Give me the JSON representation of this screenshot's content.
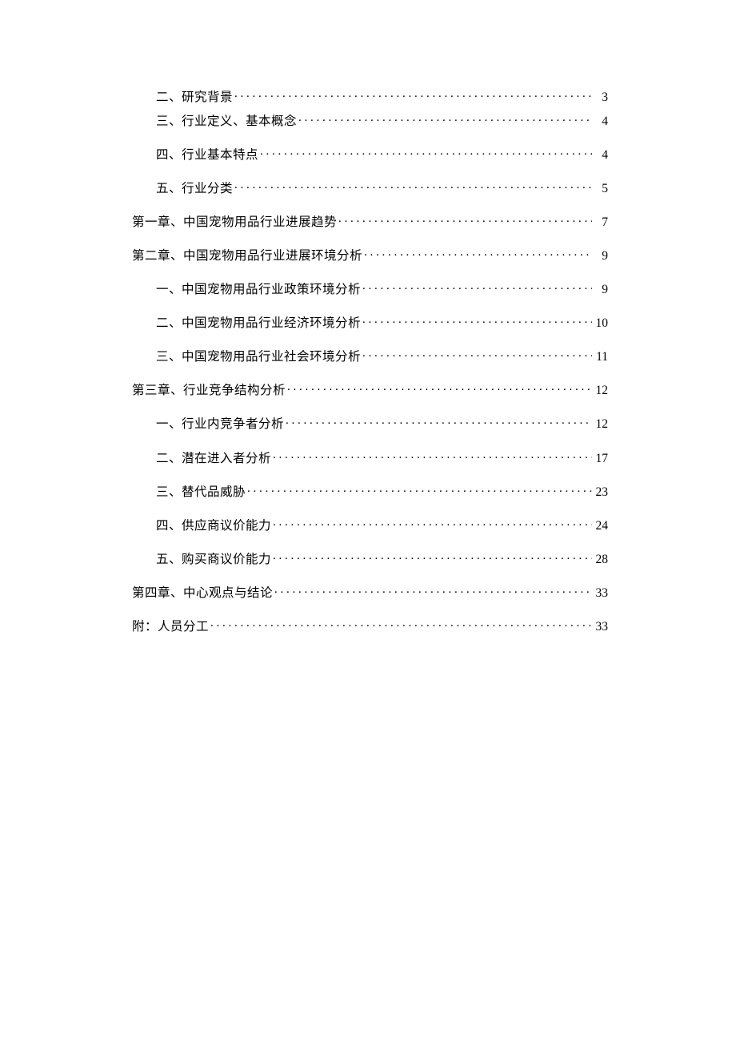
{
  "toc": [
    {
      "indent": true,
      "tight": true,
      "label": "二、研究背景",
      "page": "3"
    },
    {
      "indent": true,
      "tight": false,
      "label": "三、行业定义、基本概念",
      "page": "4"
    },
    {
      "indent": true,
      "tight": false,
      "label": "四、行业基本特点",
      "page": "4"
    },
    {
      "indent": true,
      "tight": false,
      "label": "五、行业分类",
      "page": "5"
    },
    {
      "indent": false,
      "tight": false,
      "label": "第一章、中国宠物用品行业进展趋势",
      "page": "7"
    },
    {
      "indent": false,
      "tight": false,
      "label": "第二章、中国宠物用品行业进展环境分析",
      "page": "9"
    },
    {
      "indent": true,
      "tight": false,
      "label": "一、中国宠物用品行业政策环境分析",
      "page": "9"
    },
    {
      "indent": true,
      "tight": false,
      "label": "二、中国宠物用品行业经济环境分析",
      "page": "10"
    },
    {
      "indent": true,
      "tight": false,
      "label": "三、中国宠物用品行业社会环境分析",
      "page": "11"
    },
    {
      "indent": false,
      "tight": false,
      "label": "第三章、行业竞争结构分析",
      "page": "12"
    },
    {
      "indent": true,
      "tight": false,
      "label": "一、行业内竞争者分析",
      "page": "12"
    },
    {
      "indent": true,
      "tight": false,
      "label": "二、潜在进入者分析",
      "page": "17"
    },
    {
      "indent": true,
      "tight": false,
      "label": "三、替代品威胁",
      "page": "23"
    },
    {
      "indent": true,
      "tight": false,
      "label": "四、供应商议价能力",
      "page": "24"
    },
    {
      "indent": true,
      "tight": false,
      "label": "五、购买商议价能力",
      "page": "28"
    },
    {
      "indent": false,
      "tight": false,
      "label": "第四章、中心观点与结论",
      "page": "33"
    },
    {
      "indent": false,
      "tight": false,
      "label": "附：人员分工",
      "page": "33"
    }
  ]
}
